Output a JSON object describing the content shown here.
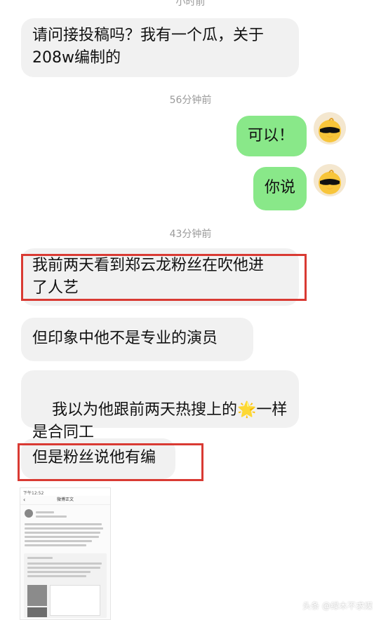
{
  "chat": {
    "timestamp_top_partial": "小时前",
    "messages": [
      {
        "text": "请问接投稿吗？我有一个瓜，关于\n208w编制的"
      },
      {
        "timestamp": "56分钟前"
      },
      {
        "text": "可以！"
      },
      {
        "text": "你说"
      },
      {
        "timestamp": "43分钟前"
      },
      {
        "text": "我前两天看到郑云龙粉丝在吹他进\n了人艺"
      },
      {
        "text": "但印象中他不是专业的演员"
      },
      {
        "text_part1": "我以为他跟前两天热搜上的",
        "emoji": "🌟",
        "text_part2": "一样\n是合同工"
      },
      {
        "text": "但是粉丝说他有编"
      }
    ]
  },
  "icons": {
    "avatar": "duck-with-sunglasses-icon",
    "back": "chevron-left-icon"
  },
  "colors": {
    "incoming_bubble": "#f1f1f1",
    "outgoing_bubble": "#89e889",
    "highlight": "#d93a33",
    "timestamp": "#9a9a9a"
  },
  "attachment": {
    "statusbar": "下午12:52",
    "navbar_title": "微博正文"
  },
  "watermark": "头条 @绿木不求煤"
}
